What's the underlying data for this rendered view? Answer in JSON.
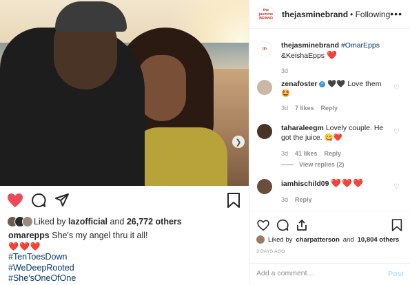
{
  "post": {
    "liked_by_prefix": "Liked by",
    "liked_by_user": "lazofficial",
    "liked_by_and": "and",
    "likes_count": "26,772 others",
    "caption_user": "omarepps",
    "caption_text": "She's my angel thru it all!",
    "caption_hearts": "❤️❤️❤️",
    "hashtags": [
      "#TenToesDown",
      "#WeDeepRooted",
      "#She'sOneOfOne"
    ]
  },
  "header": {
    "logo_text": "the jasmine BRAND",
    "username": "thejasminebrand",
    "follow_text": "• Following",
    "more_icon": "more-dots-icon"
  },
  "comments": [
    {
      "user": "thejasminebrand",
      "text": "#OmarEpps &KeishaEpps ❤️",
      "tag": "#OmarEpps",
      "rest": " &KeishaEpps",
      "emoji": "❤️",
      "time": "3d"
    },
    {
      "user": "zenafoster",
      "verified": true,
      "text": "🖤🖤 Love them 🤩",
      "time": "3d",
      "likes": "7 likes",
      "reply": "Reply"
    },
    {
      "user": "taharaleegm",
      "text": "Lovely couple. He got the juice. 😋❤️",
      "time": "3d",
      "likes": "41 likes",
      "reply": "Reply",
      "view_replies": "View replies (2)"
    },
    {
      "user": "iamhischild09",
      "text": "❤️❤️❤️",
      "time": "3d",
      "reply": "Reply"
    }
  ],
  "side": {
    "liked_by_prefix": "Liked by",
    "liked_by_user": "charpatterson",
    "liked_by_and": "and",
    "likes_count": "10,804 others",
    "days_ago": "3 DAYS AGO",
    "comment_placeholder": "Add a comment...",
    "post_label": "Post"
  },
  "colors": {
    "like_red": "#ed4956",
    "link_blue": "#00376b",
    "post_disabled": "#b2dffc",
    "meta_gray": "#8e8e8e"
  }
}
